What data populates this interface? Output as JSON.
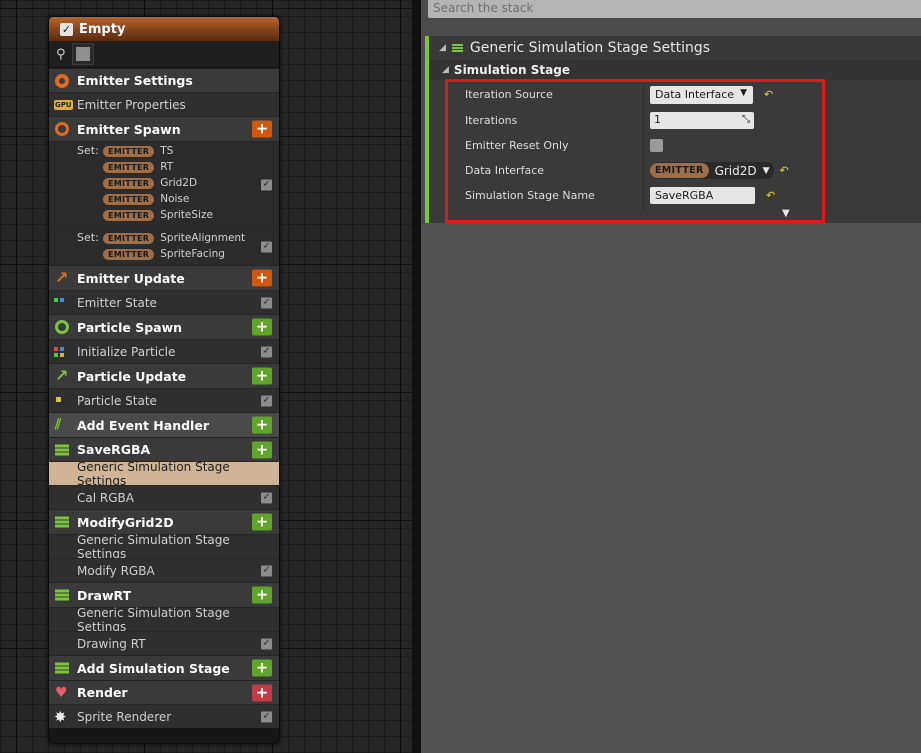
{
  "node": {
    "title": "Empty",
    "sections": {
      "emitter_settings": "Emitter Settings",
      "emitter_properties": "Emitter Properties",
      "emitter_spawn": "Emitter Spawn",
      "emitter_update": "Emitter Update",
      "emitter_state": "Emitter State",
      "particle_spawn": "Particle Spawn",
      "initialize_particle": "Initialize Particle",
      "particle_update": "Particle Update",
      "particle_state": "Particle State",
      "add_event_handler": "Add Event Handler",
      "save_rgba": "SaveRGBA",
      "save_rgba_settings": "Generic Simulation Stage Settings",
      "cal_rgba": "Cal RGBA",
      "modify_grid": "ModifyGrid2D",
      "modify_grid_settings": "Generic Simulation Stage Settings",
      "modify_rgba": "Modify RGBA",
      "draw_rt": "DrawRT",
      "draw_rt_settings": "Generic Simulation Stage Settings",
      "drawing_rt": "Drawing RT",
      "add_sim_stage": "Add Simulation Stage",
      "render": "Render",
      "sprite_renderer": "Sprite Renderer"
    },
    "gpu_badge": "GPU",
    "plus": "+",
    "check": "✓",
    "set_label": "Set:",
    "pill": "EMITTER",
    "set1": [
      "TS",
      "RT",
      "Grid2D",
      "Noise",
      "SpriteSize"
    ],
    "set2": [
      "SpriteAlignment",
      "SpriteFacing"
    ]
  },
  "stack": {
    "search_placeholder": "Search the stack",
    "group_title": "Generic Simulation Stage Settings",
    "category": "Simulation Stage",
    "props": {
      "iteration_source_label": "Iteration Source",
      "iteration_source_value": "Data Interface",
      "iterations_label": "Iterations",
      "iterations_value": "1",
      "emitter_reset_label": "Emitter Reset Only",
      "data_interface_label": "Data Interface",
      "data_interface_pill": "EMITTER",
      "data_interface_value": "Grid2D",
      "stage_name_label": "Simulation Stage Name",
      "stage_name_value": "SaveRGBA"
    }
  },
  "colors": {
    "highlight_box": "#e0181b",
    "accent_green": "#7cc43a",
    "accent_orange": "#e06b22",
    "selected_row": "#cfb595"
  }
}
